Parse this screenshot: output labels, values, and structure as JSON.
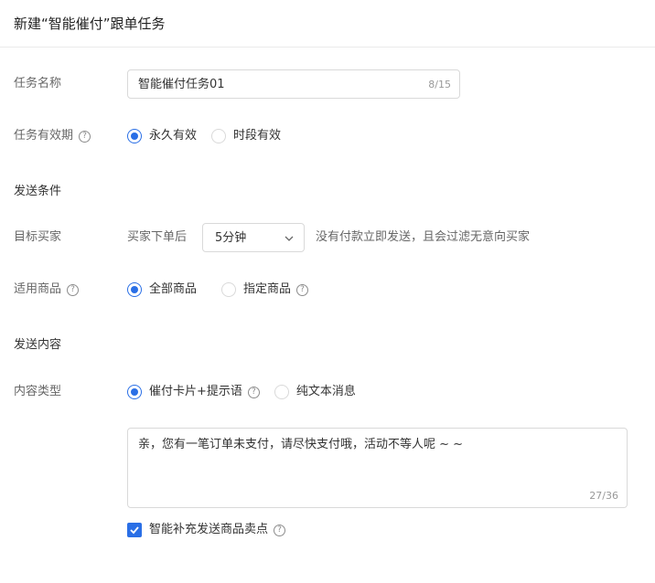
{
  "header": {
    "title": "新建“智能催付”跟单任务"
  },
  "task_name": {
    "label": "任务名称",
    "value": "智能催付任务01",
    "count": "8/15"
  },
  "validity": {
    "label": "任务有效期",
    "options": [
      {
        "label": "永久有效",
        "checked": true
      },
      {
        "label": "时段有效",
        "checked": false
      }
    ]
  },
  "send_condition": {
    "section_title": "发送条件",
    "target_label": "目标买家",
    "prefix": "买家下单后",
    "delay_selected": "5分钟",
    "suffix": "没有付款立即发送，且会过滤无意向买家"
  },
  "products": {
    "label": "适用商品",
    "options": [
      {
        "label": "全部商品",
        "checked": true
      },
      {
        "label": "指定商品",
        "checked": false
      }
    ]
  },
  "send_content": {
    "section_title": "发送内容",
    "type_label": "内容类型",
    "options": [
      {
        "label": "催付卡片+提示语",
        "checked": true
      },
      {
        "label": "纯文本消息",
        "checked": false
      }
    ],
    "message": "亲，您有一笔订单未支付，请尽快支付哦，活动不等人呢 ~ ~",
    "message_count": "27/36",
    "smart_supplement": {
      "label": "智能补充发送商品卖点",
      "checked": true
    }
  },
  "icons": {
    "help": "?"
  },
  "colors": {
    "accent": "#2a6fe6",
    "border": "#d9d9d9",
    "muted": "#999999"
  }
}
